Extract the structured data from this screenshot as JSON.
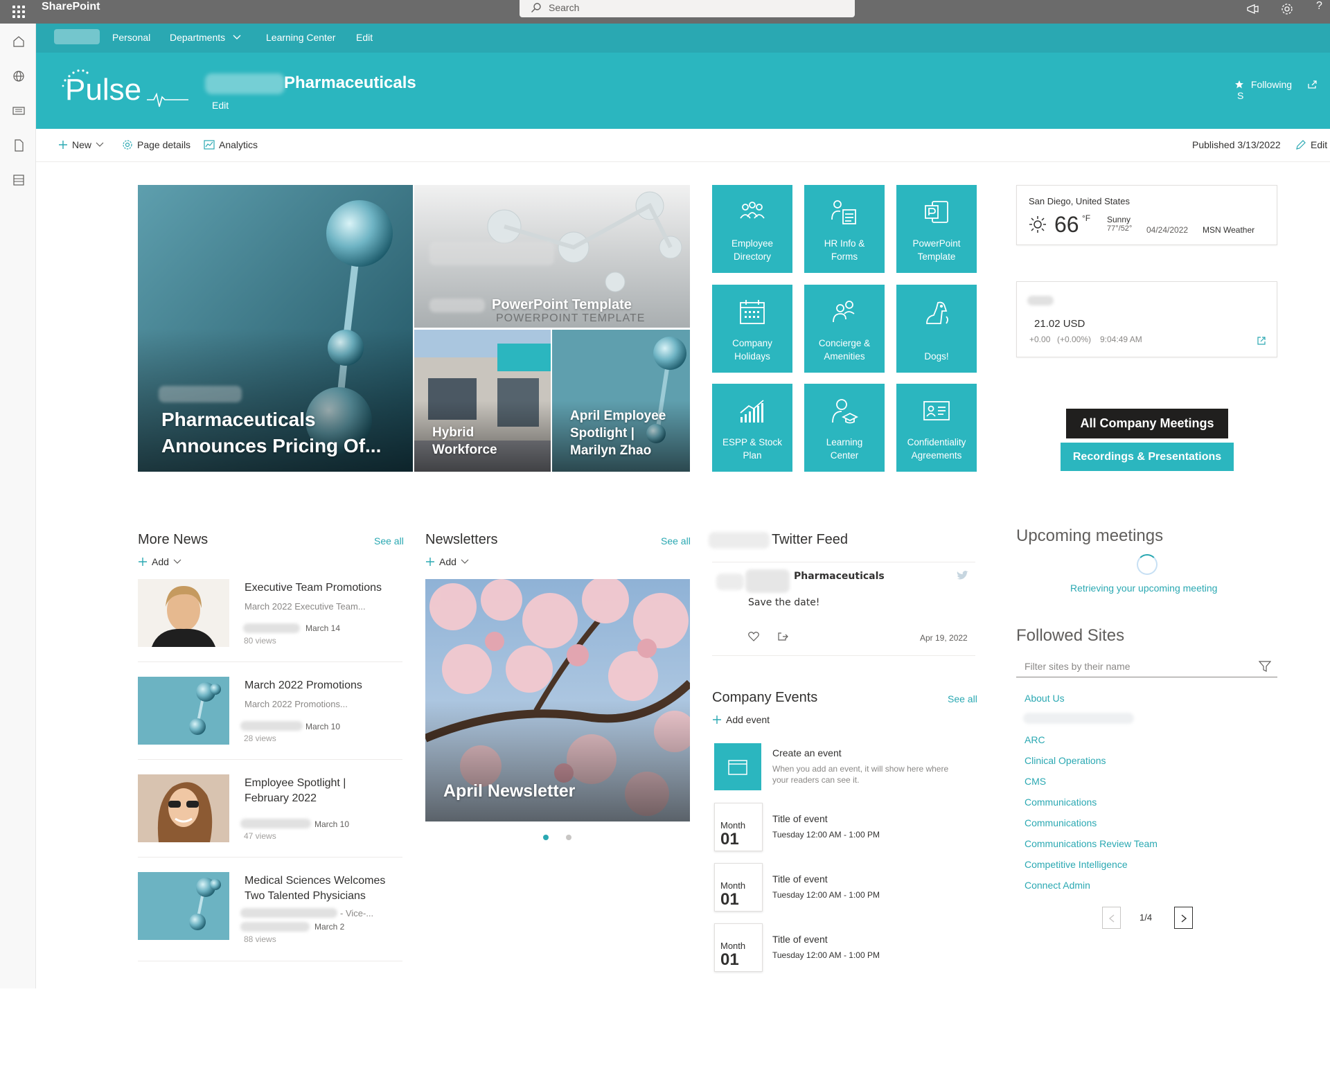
{
  "suite": {
    "app_name": "SharePoint",
    "search_placeholder": "Search"
  },
  "hubnav": {
    "items": [
      "Personal",
      "Departments",
      "Learning Center",
      "Edit"
    ]
  },
  "site": {
    "logo_text": "Pulse",
    "title": "Pharmaceuticals",
    "edit": "Edit",
    "following": "Following",
    "share_partial": "S"
  },
  "commandbar": {
    "new": "New",
    "page_details": "Page details",
    "analytics": "Analytics",
    "published": "Published 3/13/2022",
    "edit": "Edit"
  },
  "hero": {
    "main_caption_line1": "Pharmaceuticals",
    "main_caption_line2": "Announces Pricing Of...",
    "top_right_caption": "PowerPoint Template",
    "top_right_subtext": "POWERPOINT TEMPLATE",
    "bottom_left_caption_line1": "Hybrid",
    "bottom_left_caption_line2": "Workforce",
    "bottom_right_caption_line1": "April Employee",
    "bottom_right_caption_line2": "Spotlight |",
    "bottom_right_caption_line3": "Marilyn Zhao"
  },
  "tiles": [
    {
      "line1": "Employee",
      "line2": "Directory",
      "icon": "people-icon"
    },
    {
      "line1": "HR Info &",
      "line2": "Forms",
      "icon": "hr-forms-icon"
    },
    {
      "line1": "PowerPoint",
      "line2": "Template",
      "icon": "powerpoint-icon"
    },
    {
      "line1": "Company",
      "line2": "Holidays",
      "icon": "calendar-icon"
    },
    {
      "line1": "Concierge &",
      "line2": "Amenities",
      "icon": "concierge-icon"
    },
    {
      "line1": "",
      "line2": "Dogs!",
      "icon": "dog-icon"
    },
    {
      "line1": "ESPP & Stock",
      "line2": "Plan",
      "icon": "chart-icon"
    },
    {
      "line1": "Learning",
      "line2": "Center",
      "icon": "learning-icon"
    },
    {
      "line1": "Confidentiality",
      "line2": "Agreements",
      "icon": "id-card-icon"
    }
  ],
  "weather": {
    "location": "San Diego, United States",
    "temp": "66",
    "unit": "°F",
    "condition": "Sunny",
    "hilo": "77°/52°",
    "date": "04/24/2022",
    "source": "MSN Weather"
  },
  "stock": {
    "price": "21.02 USD",
    "change": "+0.00",
    "change_pct": "(+0.00%)",
    "time": "9:04:49 AM"
  },
  "buttons": {
    "all_company_meetings": "All Company Meetings",
    "recordings": "Recordings & Presentations"
  },
  "more_news": {
    "title": "More News",
    "see_all": "See all",
    "add": "Add",
    "items": [
      {
        "title_line1": "Executive Team Promotions",
        "title_line2": "",
        "sub": "March 2022 Executive Team...",
        "date": "March 14",
        "views": "80 views"
      },
      {
        "title_line1": "March 2022 Promotions",
        "title_line2": "",
        "sub": "March 2022 Promotions...",
        "date": "March 10",
        "views": "28 views"
      },
      {
        "title_line1": "Employee Spotlight |",
        "title_line2": "February 2022",
        "sub": "",
        "date": "March 10",
        "views": "47 views"
      },
      {
        "title_line1": "Medical Sciences Welcomes",
        "title_line2": "Two Talented Physicians",
        "sub": "- Vice-...",
        "date": "March 2",
        "views": "88 views"
      }
    ]
  },
  "newsletters": {
    "title": "Newsletters",
    "see_all": "See all",
    "add": "Add",
    "caption": "April Newsletter"
  },
  "twitter": {
    "title": "Twitter Feed",
    "account": "Pharmaceuticals",
    "tweet": "Save the date!",
    "date": "Apr 19, 2022"
  },
  "events": {
    "title": "Company Events",
    "see_all": "See all",
    "add": "Add event",
    "create_title": "Create an event",
    "create_desc_line1": "When you add an event, it will show here where",
    "create_desc_line2": "your readers can see it.",
    "items": [
      {
        "month": "Month",
        "day": "01",
        "title": "Title of event",
        "time": "Tuesday 12:00 AM - 1:00 PM"
      },
      {
        "month": "Month",
        "day": "01",
        "title": "Title of event",
        "time": "Tuesday 12:00 AM - 1:00 PM"
      },
      {
        "month": "Month",
        "day": "01",
        "title": "Title of event",
        "time": "Tuesday 12:00 AM - 1:00 PM"
      }
    ]
  },
  "meetings": {
    "title": "Upcoming meetings",
    "loading": "Retrieving your upcoming meeting"
  },
  "followed": {
    "title": "Followed Sites",
    "filter_placeholder": "Filter sites by their name",
    "sites": [
      "About Us",
      "ARC",
      "Clinical Operations",
      "CMS",
      "Communications",
      "Communications",
      "Communications Review Team",
      "Competitive Intelligence",
      "Connect Admin"
    ],
    "pager": "1/4"
  },
  "colors": {
    "brand": "#2bb6bf",
    "hub": "#2aa8b2",
    "suite": "#6b6b6b",
    "dark_button": "#201f1e"
  }
}
